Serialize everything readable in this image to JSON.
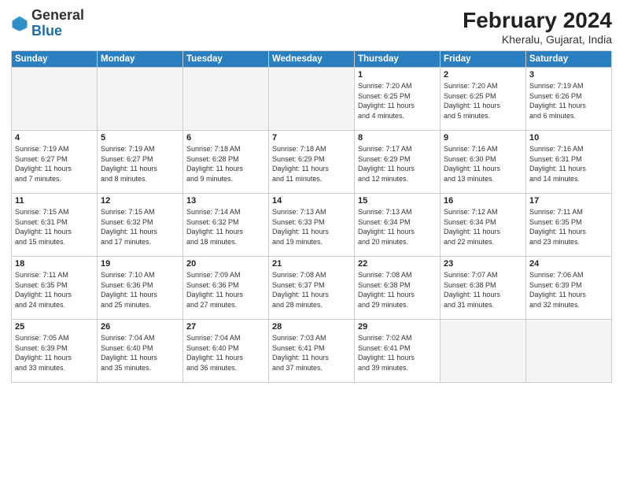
{
  "header": {
    "logo_general": "General",
    "logo_blue": "Blue",
    "month_year": "February 2024",
    "location": "Kheralu, Gujarat, India"
  },
  "days_of_week": [
    "Sunday",
    "Monday",
    "Tuesday",
    "Wednesday",
    "Thursday",
    "Friday",
    "Saturday"
  ],
  "weeks": [
    [
      {
        "day": "",
        "info": ""
      },
      {
        "day": "",
        "info": ""
      },
      {
        "day": "",
        "info": ""
      },
      {
        "day": "",
        "info": ""
      },
      {
        "day": "1",
        "info": "Sunrise: 7:20 AM\nSunset: 6:25 PM\nDaylight: 11 hours\nand 4 minutes."
      },
      {
        "day": "2",
        "info": "Sunrise: 7:20 AM\nSunset: 6:25 PM\nDaylight: 11 hours\nand 5 minutes."
      },
      {
        "day": "3",
        "info": "Sunrise: 7:19 AM\nSunset: 6:26 PM\nDaylight: 11 hours\nand 6 minutes."
      }
    ],
    [
      {
        "day": "4",
        "info": "Sunrise: 7:19 AM\nSunset: 6:27 PM\nDaylight: 11 hours\nand 7 minutes."
      },
      {
        "day": "5",
        "info": "Sunrise: 7:19 AM\nSunset: 6:27 PM\nDaylight: 11 hours\nand 8 minutes."
      },
      {
        "day": "6",
        "info": "Sunrise: 7:18 AM\nSunset: 6:28 PM\nDaylight: 11 hours\nand 9 minutes."
      },
      {
        "day": "7",
        "info": "Sunrise: 7:18 AM\nSunset: 6:29 PM\nDaylight: 11 hours\nand 11 minutes."
      },
      {
        "day": "8",
        "info": "Sunrise: 7:17 AM\nSunset: 6:29 PM\nDaylight: 11 hours\nand 12 minutes."
      },
      {
        "day": "9",
        "info": "Sunrise: 7:16 AM\nSunset: 6:30 PM\nDaylight: 11 hours\nand 13 minutes."
      },
      {
        "day": "10",
        "info": "Sunrise: 7:16 AM\nSunset: 6:31 PM\nDaylight: 11 hours\nand 14 minutes."
      }
    ],
    [
      {
        "day": "11",
        "info": "Sunrise: 7:15 AM\nSunset: 6:31 PM\nDaylight: 11 hours\nand 15 minutes."
      },
      {
        "day": "12",
        "info": "Sunrise: 7:15 AM\nSunset: 6:32 PM\nDaylight: 11 hours\nand 17 minutes."
      },
      {
        "day": "13",
        "info": "Sunrise: 7:14 AM\nSunset: 6:32 PM\nDaylight: 11 hours\nand 18 minutes."
      },
      {
        "day": "14",
        "info": "Sunrise: 7:13 AM\nSunset: 6:33 PM\nDaylight: 11 hours\nand 19 minutes."
      },
      {
        "day": "15",
        "info": "Sunrise: 7:13 AM\nSunset: 6:34 PM\nDaylight: 11 hours\nand 20 minutes."
      },
      {
        "day": "16",
        "info": "Sunrise: 7:12 AM\nSunset: 6:34 PM\nDaylight: 11 hours\nand 22 minutes."
      },
      {
        "day": "17",
        "info": "Sunrise: 7:11 AM\nSunset: 6:35 PM\nDaylight: 11 hours\nand 23 minutes."
      }
    ],
    [
      {
        "day": "18",
        "info": "Sunrise: 7:11 AM\nSunset: 6:35 PM\nDaylight: 11 hours\nand 24 minutes."
      },
      {
        "day": "19",
        "info": "Sunrise: 7:10 AM\nSunset: 6:36 PM\nDaylight: 11 hours\nand 25 minutes."
      },
      {
        "day": "20",
        "info": "Sunrise: 7:09 AM\nSunset: 6:36 PM\nDaylight: 11 hours\nand 27 minutes."
      },
      {
        "day": "21",
        "info": "Sunrise: 7:08 AM\nSunset: 6:37 PM\nDaylight: 11 hours\nand 28 minutes."
      },
      {
        "day": "22",
        "info": "Sunrise: 7:08 AM\nSunset: 6:38 PM\nDaylight: 11 hours\nand 29 minutes."
      },
      {
        "day": "23",
        "info": "Sunrise: 7:07 AM\nSunset: 6:38 PM\nDaylight: 11 hours\nand 31 minutes."
      },
      {
        "day": "24",
        "info": "Sunrise: 7:06 AM\nSunset: 6:39 PM\nDaylight: 11 hours\nand 32 minutes."
      }
    ],
    [
      {
        "day": "25",
        "info": "Sunrise: 7:05 AM\nSunset: 6:39 PM\nDaylight: 11 hours\nand 33 minutes."
      },
      {
        "day": "26",
        "info": "Sunrise: 7:04 AM\nSunset: 6:40 PM\nDaylight: 11 hours\nand 35 minutes."
      },
      {
        "day": "27",
        "info": "Sunrise: 7:04 AM\nSunset: 6:40 PM\nDaylight: 11 hours\nand 36 minutes."
      },
      {
        "day": "28",
        "info": "Sunrise: 7:03 AM\nSunset: 6:41 PM\nDaylight: 11 hours\nand 37 minutes."
      },
      {
        "day": "29",
        "info": "Sunrise: 7:02 AM\nSunset: 6:41 PM\nDaylight: 11 hours\nand 39 minutes."
      },
      {
        "day": "",
        "info": ""
      },
      {
        "day": "",
        "info": ""
      }
    ]
  ]
}
